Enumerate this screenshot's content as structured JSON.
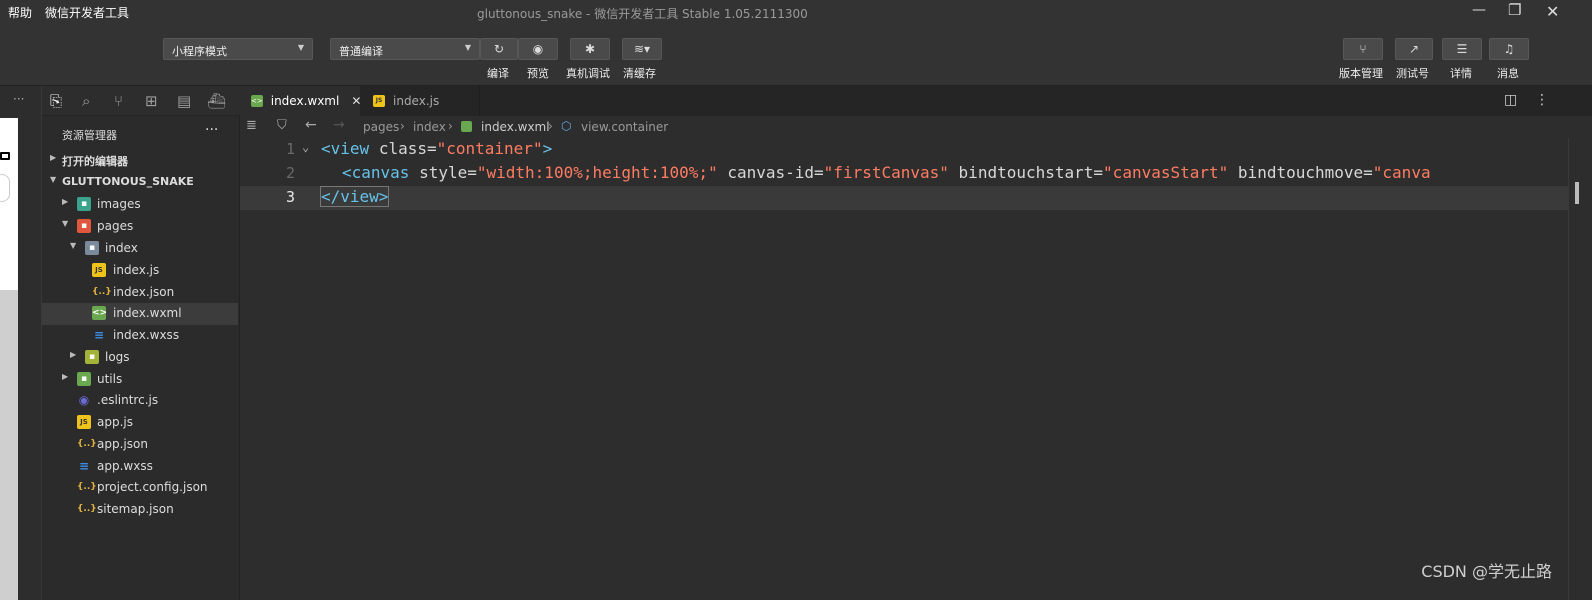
{
  "menu": {
    "help": "帮助",
    "tool": "微信开发者工具"
  },
  "window": {
    "title": "gluttonous_snake",
    "subtitle": " - 微信开发者工具 Stable 1.05.2111300"
  },
  "toolbar": {
    "mode": "小程序模式",
    "compile_mode": "普通编译",
    "labels": {
      "compile": "编译",
      "preview": "预览",
      "remote_debug": "真机调试",
      "clear_cache": "清缓存"
    },
    "right_labels": {
      "version": "版本管理",
      "test": "测试号",
      "details": "详情",
      "messages": "消息"
    }
  },
  "sidebar": {
    "title": "资源管理器",
    "more": "···",
    "open_editors": "打开的编辑器",
    "project": "GLUTTONOUS_SNAKE",
    "items": [
      {
        "label": "images"
      },
      {
        "label": "pages"
      },
      {
        "label": "index"
      },
      {
        "label": "index.js"
      },
      {
        "label": "index.json"
      },
      {
        "label": "index.wxml"
      },
      {
        "label": "index.wxss"
      },
      {
        "label": "logs"
      },
      {
        "label": "utils"
      },
      {
        "label": ".eslintrc.js"
      },
      {
        "label": "app.js"
      },
      {
        "label": "app.json"
      },
      {
        "label": "app.wxss"
      },
      {
        "label": "project.config.json"
      },
      {
        "label": "sitemap.json"
      }
    ]
  },
  "tabs": [
    {
      "label": "index.wxml",
      "close": "✕"
    },
    {
      "label": "index.js"
    }
  ],
  "breadcrumb": {
    "p1": "pages",
    "p2": "index",
    "p3": "index.wxml",
    "p4": "view.container"
  },
  "editor": {
    "lines": [
      {
        "num": "1",
        "parts": [
          "<view",
          "class=",
          "\"container\"",
          ">"
        ]
      },
      {
        "num": "2",
        "parts": [
          "<canvas",
          "style=",
          "\"width:100%;height:100%;\"",
          "canvas-id=",
          "\"firstCanvas\"",
          "bindtouchstart=",
          "\"canvasStart\"",
          "bindtouchmove=",
          "\"canva"
        ]
      },
      {
        "num": "3",
        "parts": [
          "</view>"
        ]
      }
    ]
  },
  "watermark": "CSDN @学无止路",
  "colors": {
    "tag": "#66c2e8",
    "string": "#ff7c62",
    "attr": "#d7d7d7"
  }
}
